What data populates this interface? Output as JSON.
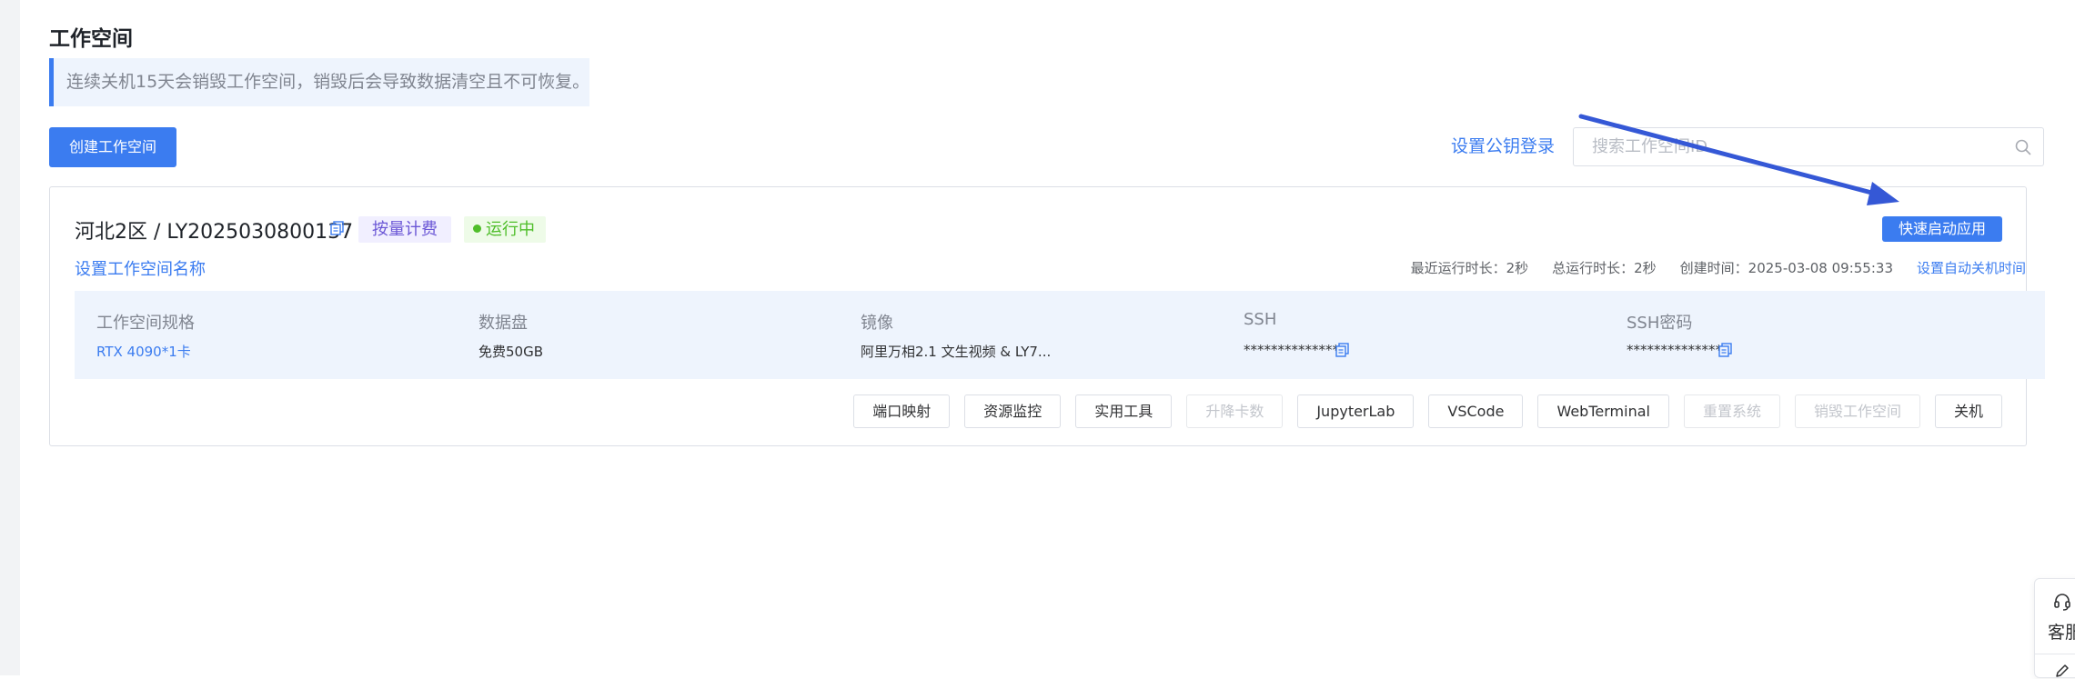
{
  "page": {
    "title": "工作空间",
    "notice": "连续关机15天会销毁工作空间，销毁后会导致数据清空且不可恢复。"
  },
  "toolbar": {
    "create_label": "创建工作空间",
    "pubkey_label": "设置公钥登录",
    "search_placeholder": "搜索工作空间ID"
  },
  "workspace": {
    "name": "河北2区 / LY2025030800137",
    "billing_tag": "按量计费",
    "status": "运行中",
    "status_color": "#4fbe2a",
    "quick_launch_label": "快速启动应用",
    "set_name_label": "设置工作空间名称",
    "recent_runtime": "最近运行时长：2秒",
    "total_runtime": "总运行时长：2秒",
    "created_at": "创建时间：2025-03-08 09:55:33",
    "auto_shutdown_label": "设置自动关机时间",
    "specs": [
      {
        "label": "工作空间规格",
        "value": "RTX 4090*1卡"
      },
      {
        "label": "数据盘",
        "value": "免费50GB"
      },
      {
        "label": "镜像",
        "value": "阿里万相2.1 文生视频 & LY7..."
      },
      {
        "label": "SSH",
        "value": "**************"
      },
      {
        "label": "SSH密码",
        "value": "**************"
      }
    ],
    "actions": [
      {
        "label": "端口映射",
        "enabled": true
      },
      {
        "label": "资源监控",
        "enabled": true
      },
      {
        "label": "实用工具",
        "enabled": true
      },
      {
        "label": "升降卡数",
        "enabled": false
      },
      {
        "label": "JupyterLab",
        "enabled": true
      },
      {
        "label": "VSCode",
        "enabled": true
      },
      {
        "label": "WebTerminal",
        "enabled": true
      },
      {
        "label": "重置系统",
        "enabled": false
      },
      {
        "label": "销毁工作空间",
        "enabled": false
      },
      {
        "label": "关机",
        "enabled": true
      }
    ]
  },
  "floating": {
    "service_label": "客服",
    "service_icon": "headset-icon",
    "feedback_icon": "pen-icon"
  },
  "colors": {
    "accent": "#3b7cf0",
    "annotation_arrow": "#3558d6"
  }
}
